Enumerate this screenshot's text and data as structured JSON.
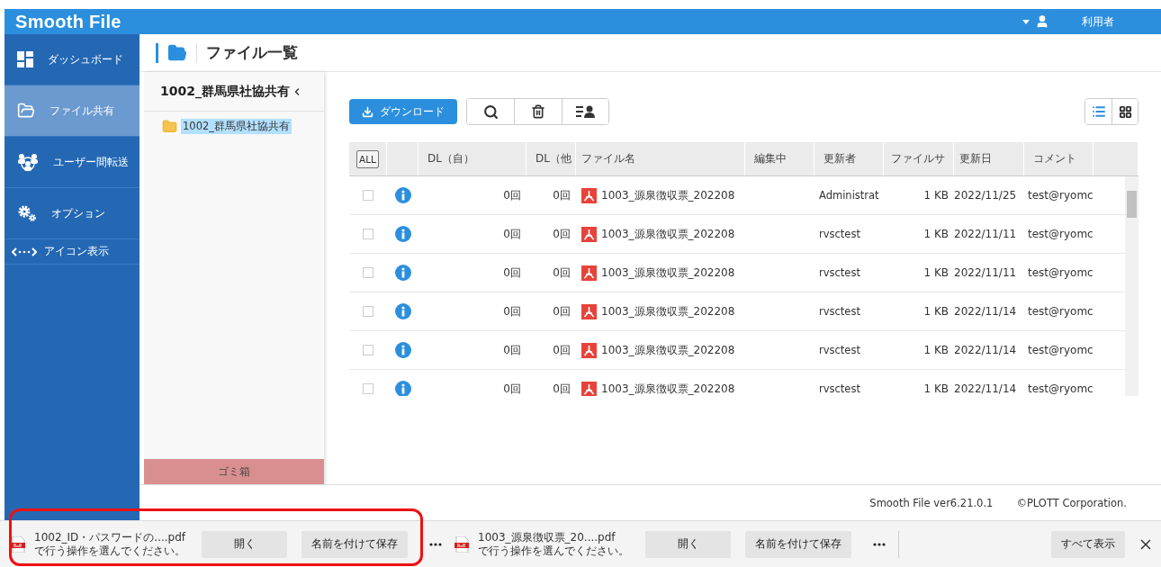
{
  "app": {
    "logo": "Smooth File",
    "user": "利用者"
  },
  "sidebar": {
    "items": [
      {
        "kind": "dashboard",
        "label": "ダッシュボード",
        "selected": false
      },
      {
        "kind": "share",
        "label": "ファイル共有",
        "selected": true
      },
      {
        "kind": "transfer",
        "label": "ユーザー間転送",
        "selected": false
      },
      {
        "kind": "options",
        "label": "オプション",
        "selected": false
      }
    ],
    "toggle": "アイコン表示"
  },
  "page_title": "ファイル一覧",
  "tree": {
    "header": "1002_群馬県社協共有",
    "items": [
      {
        "label": "1002_群馬県社協共有",
        "selected": true
      }
    ],
    "trash": "ゴミ箱"
  },
  "toolbar": {
    "download": "ダウンロード",
    "views": [
      {
        "kind": "list",
        "selected": true
      },
      {
        "kind": "grid",
        "selected": false
      }
    ]
  },
  "table": {
    "select_all": "ALL",
    "columns": [
      "DL（自）",
      "DL（他",
      "ファイル名",
      "編集中",
      "更新者",
      "ファイルサ",
      "更新日",
      "コメント"
    ],
    "rows": [
      {
        "checked": false,
        "dl_self": "0回",
        "dl_other": "0回",
        "file": "1003_源泉徴収票_202208",
        "updater": "Administrat",
        "size": "1 KB",
        "date": "2022/11/25",
        "comment": "test@ryomc"
      },
      {
        "checked": false,
        "dl_self": "0回",
        "dl_other": "0回",
        "file": "1003_源泉徴収票_202208",
        "updater": "rvsctest",
        "size": "1 KB",
        "date": "2022/11/11",
        "comment": "test@ryomc"
      },
      {
        "checked": false,
        "dl_self": "0回",
        "dl_other": "0回",
        "file": "1003_源泉徴収票_202208",
        "updater": "rvsctest",
        "size": "1 KB",
        "date": "2022/11/11",
        "comment": "test@ryomc"
      },
      {
        "checked": false,
        "dl_self": "0回",
        "dl_other": "0回",
        "file": "1003_源泉徴収票_202208",
        "updater": "rvsctest",
        "size": "1 KB",
        "date": "2022/11/14",
        "comment": "test@ryomc"
      },
      {
        "checked": false,
        "dl_self": "0回",
        "dl_other": "0回",
        "file": "1003_源泉徴収票_202208",
        "updater": "rvsctest",
        "size": "1 KB",
        "date": "2022/11/14",
        "comment": "test@ryomc"
      },
      {
        "checked": false,
        "dl_self": "0回",
        "dl_other": "0回",
        "file": "1003_源泉徴収票_202208",
        "updater": "rvsctest",
        "size": "1 KB",
        "date": "2022/11/14",
        "comment": "test@ryomc"
      }
    ]
  },
  "footer": {
    "version": "Smooth File ver6.21.0.1",
    "copyright": "©PLOTT Corporation."
  },
  "downloads": {
    "items": [
      {
        "name": "1002_ID・パスワードの....pdf",
        "prompt": "で行う操作を選んでください。",
        "open": "開く",
        "save": "名前を付けて保存"
      },
      {
        "name": "1003_源泉徴収票_20....pdf",
        "prompt": "で行う操作を選んでください。",
        "open": "開く",
        "save": "名前を付けて保存"
      }
    ],
    "show_all": "すべて表示"
  }
}
